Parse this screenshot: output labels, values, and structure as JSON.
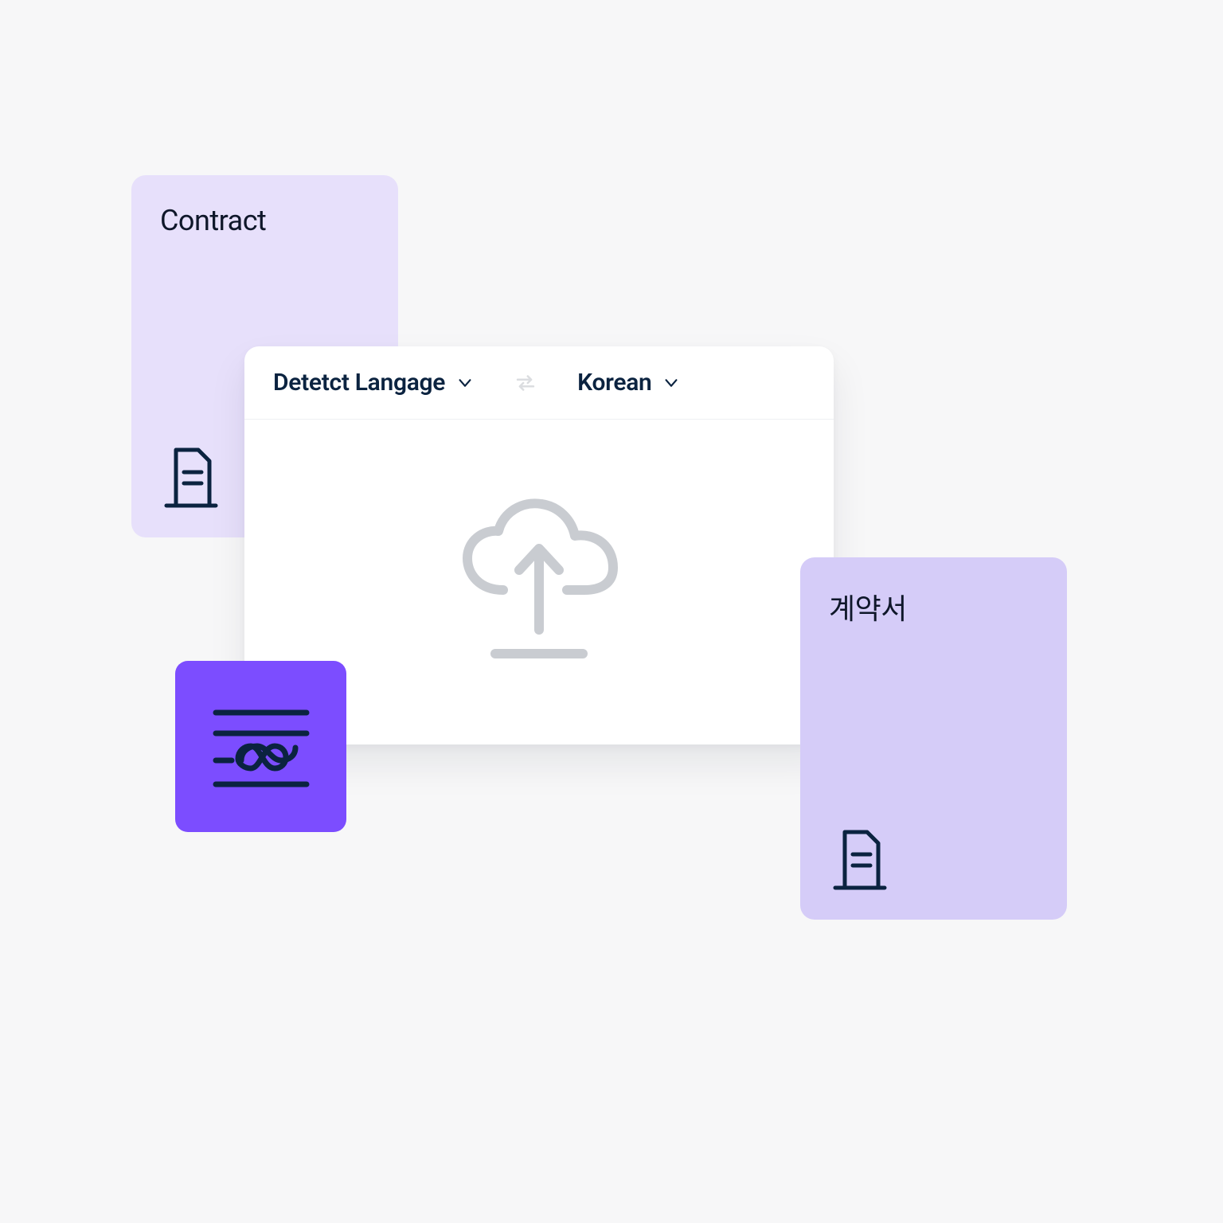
{
  "source_card": {
    "title": "Contract",
    "icon_name": "file-document-icon"
  },
  "target_card": {
    "title": "계약서",
    "icon_name": "file-document-icon"
  },
  "translator": {
    "source_language_label": "Detetct Langage",
    "target_language_label": "Korean",
    "swap_icon": "swap-arrows-icon",
    "upload_icon": "cloud-upload-icon"
  },
  "feature_tile": {
    "icon_name": "text-infinity-icon"
  },
  "colors": {
    "card_light": "#e7e0fb",
    "card_dark": "#d5ccf8",
    "tile": "#7c4dff",
    "text_primary": "#0b2340",
    "icon_muted": "#c9ccd1"
  }
}
